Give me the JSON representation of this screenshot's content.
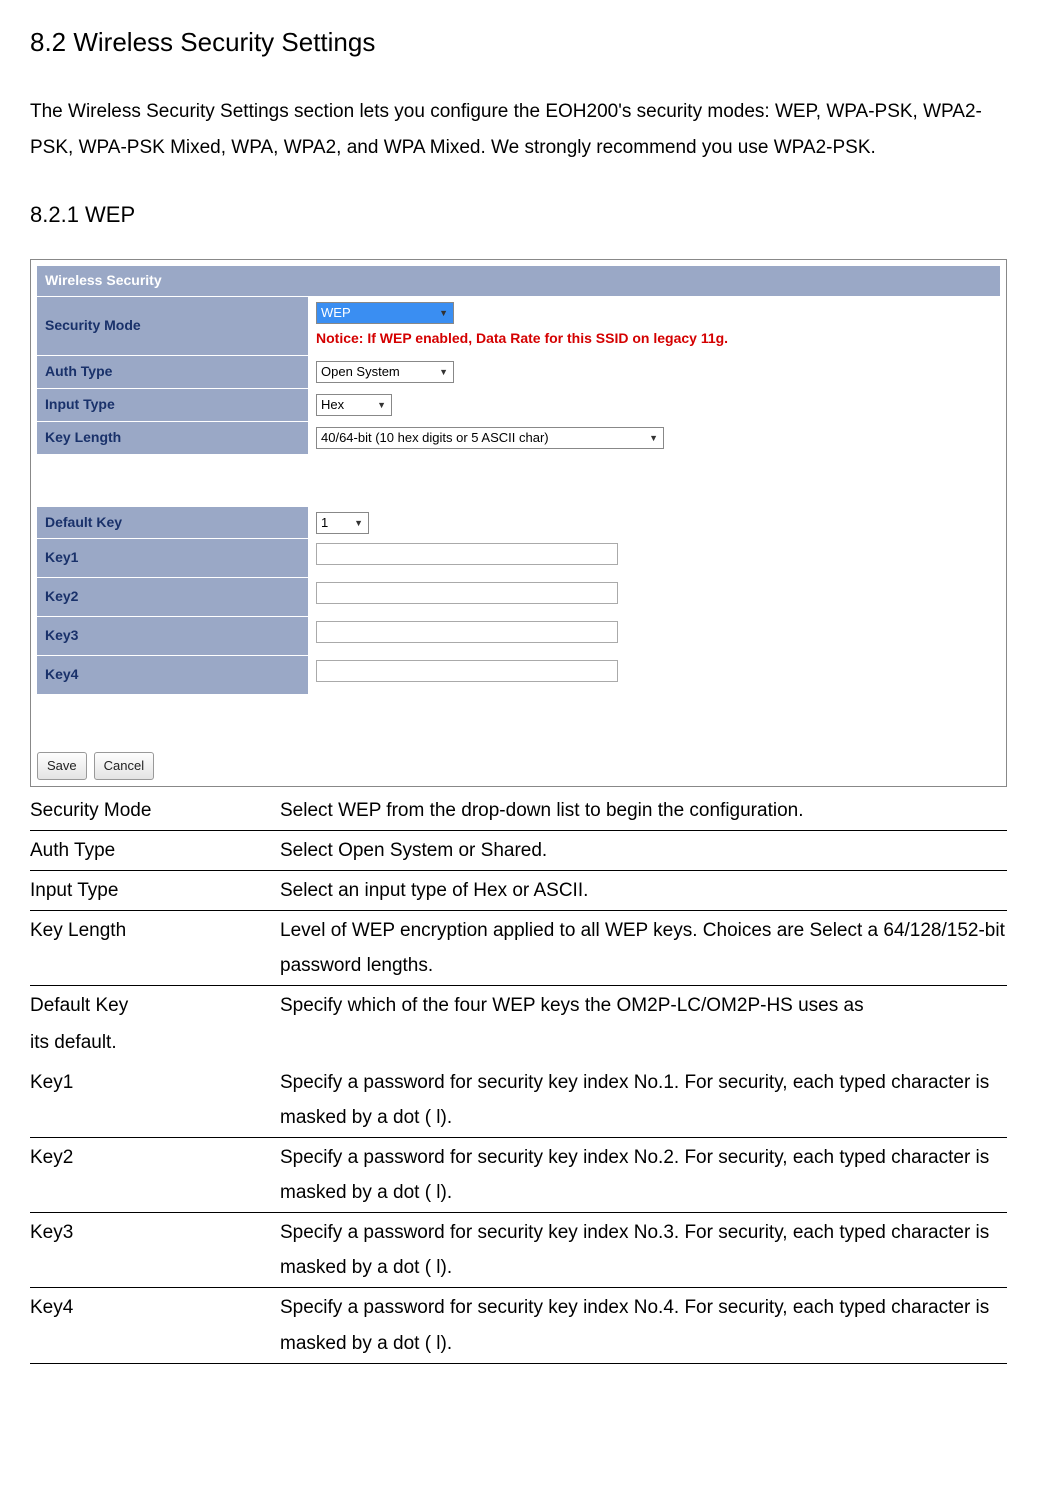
{
  "section_title": "8.2 Wireless Security Settings",
  "intro": "The Wireless Security Settings section lets you configure the EOH200's security modes: WEP, WPA-PSK, WPA2-PSK, WPA-PSK Mixed, WPA, WPA2, and WPA Mixed. We strongly recommend you use WPA2-PSK.",
  "subsection_title": "8.2.1 WEP",
  "panel": {
    "header": "Wireless Security",
    "rows": {
      "security_mode": {
        "label": "Security Mode",
        "value": "WEP"
      },
      "notice": "Notice: If WEP enabled, Data Rate for this SSID on legacy 11g.",
      "auth_type": {
        "label": "Auth Type",
        "value": "Open System"
      },
      "input_type": {
        "label": "Input Type",
        "value": "Hex"
      },
      "key_length": {
        "label": "Key Length",
        "value": "40/64-bit (10 hex digits or 5 ASCII char)"
      },
      "default_key": {
        "label": "Default Key",
        "value": "1"
      },
      "key1": {
        "label": "Key1"
      },
      "key2": {
        "label": "Key2"
      },
      "key3": {
        "label": "Key3"
      },
      "key4": {
        "label": "Key4"
      }
    },
    "buttons": {
      "save": "Save",
      "cancel": "Cancel"
    }
  },
  "desc": {
    "security_mode": {
      "term": "Security Mode",
      "text": "Select WEP from the drop-down  list to begin the configuration."
    },
    "auth_type": {
      "term": "Auth Type",
      "text": "Select Open System or Shared."
    },
    "input_type": {
      "term": "Input Type",
      "text": "Select an input type of Hex or ASCII."
    },
    "key_length": {
      "term": "Key Length",
      "text": "Level of WEP encryption applied to all WEP keys. Choices are Select a 64/128/152-bit password lengths."
    },
    "default_key": {
      "term": "Default Key",
      "text": "Specify which of the four WEP keys the OM2P-LC/OM2P-HS  uses as"
    },
    "default_key_cont": "its default.",
    "key1": {
      "term": "Key1",
      "text": "Specify a password for security key index No.1. For security, each typed character is masked by a dot (   l)."
    },
    "key2": {
      "term": "Key2",
      "text": "Specify a password for security key index No.2. For security, each typed character is masked by a dot (   l)."
    },
    "key3": {
      "term": "Key3",
      "text": "Specify a password for security key index No.3. For security, each typed character is masked by a dot (   l)."
    },
    "key4": {
      "term": "Key4",
      "text": "Specify a password for security key index No.4. For security, each typed character is masked by a dot (   l)."
    }
  }
}
